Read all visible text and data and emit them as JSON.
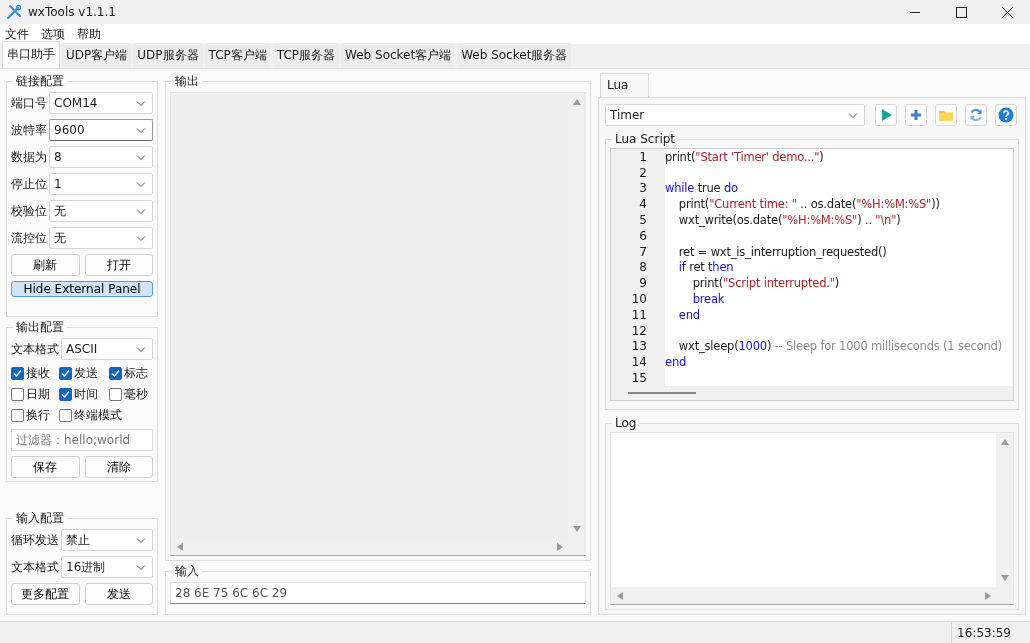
{
  "window": {
    "title": "wxTools v1.1.1"
  },
  "menu": [
    "文件",
    "选项",
    "帮助"
  ],
  "tabs": [
    {
      "label": "串口助手",
      "selected": true
    },
    {
      "label": "UDP客户端",
      "selected": false
    },
    {
      "label": "UDP服务器",
      "selected": false
    },
    {
      "label": "TCP客户端",
      "selected": false
    },
    {
      "label": "TCP服务器",
      "selected": false
    },
    {
      "label": "Web Socket客户端",
      "selected": false
    },
    {
      "label": "Web Socket服务器",
      "selected": false
    }
  ],
  "link_config": {
    "title": "链接配置",
    "fields": [
      {
        "label": "端口号",
        "value": "COM14",
        "focused": false
      },
      {
        "label": "波特率",
        "value": "9600",
        "focused": true
      },
      {
        "label": "数据为",
        "value": "8",
        "focused": false
      },
      {
        "label": "停止位",
        "value": "1",
        "focused": false
      },
      {
        "label": "校验位",
        "value": "无",
        "focused": false
      },
      {
        "label": "流控位",
        "value": "无",
        "focused": false
      }
    ],
    "buttons": [
      "刷新",
      "打开"
    ],
    "panel_button": "Hide External Panel"
  },
  "output_config": {
    "title": "输出配置",
    "format": {
      "label": "文本格式",
      "value": "ASCII"
    },
    "options": [
      {
        "label": "接收",
        "checked": true
      },
      {
        "label": "发送",
        "checked": true
      },
      {
        "label": "标志",
        "checked": true
      },
      {
        "label": "日期",
        "checked": false
      },
      {
        "label": "时间",
        "checked": true
      },
      {
        "label": "毫秒",
        "checked": false
      },
      {
        "label": "换行",
        "checked": false
      },
      {
        "label": "终端模式",
        "checked": false
      }
    ],
    "filter": {
      "placeholder": "过滤器：hello;world"
    },
    "buttons": [
      "保存",
      "清除"
    ]
  },
  "input_config": {
    "title": "输入配置",
    "fields": [
      {
        "label": "循环发送",
        "value": "禁止"
      },
      {
        "label": "文本格式",
        "value": "16进制"
      }
    ],
    "buttons": [
      "更多配置",
      "发送"
    ]
  },
  "output": {
    "title": "输出"
  },
  "input": {
    "title": "输入",
    "value": "28 6E 75 6C 6C 29"
  },
  "side_tabs": [
    {
      "label": "Lua",
      "selected": true
    }
  ],
  "script_select": {
    "value": "Timer"
  },
  "script": {
    "title": "Lua Script",
    "lines": [
      {
        "number": "1",
        "tokens": [
          {
            "kind": "plain",
            "text": "print("
          },
          {
            "kind": "string",
            "text": "\"Start 'Timer' demo...\""
          },
          {
            "kind": "plain",
            "text": ")"
          }
        ]
      },
      {
        "number": "2"
      },
      {
        "number": "3",
        "tokens": [
          {
            "kind": "keyword",
            "text": "while"
          },
          {
            "kind": "plain",
            "text": " true "
          },
          {
            "kind": "keyword",
            "text": "do"
          }
        ]
      },
      {
        "number": "4",
        "tokens": [
          {
            "kind": "plain",
            "text": "    print("
          },
          {
            "kind": "string",
            "text": "\"Current time: \""
          },
          {
            "kind": "plain",
            "text": " .. os.date("
          },
          {
            "kind": "string",
            "text": "\"%H:%M:%S\""
          },
          {
            "kind": "plain",
            "text": "))"
          }
        ]
      },
      {
        "number": "5",
        "tokens": [
          {
            "kind": "plain",
            "text": "    wxt_write(os.date("
          },
          {
            "kind": "string",
            "text": "\"%H:%M:%S\""
          },
          {
            "kind": "plain",
            "text": ") .. "
          },
          {
            "kind": "string",
            "text": "\"\\n\""
          },
          {
            "kind": "plain",
            "text": ")"
          }
        ]
      },
      {
        "number": "6"
      },
      {
        "number": "7",
        "tokens": [
          {
            "kind": "plain",
            "text": "    ret = wxt_is_interruption_requested()"
          }
        ]
      },
      {
        "number": "8",
        "tokens": [
          {
            "kind": "keyword",
            "text": "    if"
          },
          {
            "kind": "plain",
            "text": " ret "
          },
          {
            "kind": "keyword",
            "text": "then"
          }
        ]
      },
      {
        "number": "9",
        "tokens": [
          {
            "kind": "plain",
            "text": "        print("
          },
          {
            "kind": "string",
            "text": "\"Script interrupted.\""
          },
          {
            "kind": "plain",
            "text": ")"
          }
        ]
      },
      {
        "number": "10",
        "tokens": [
          {
            "kind": "keyword",
            "text": "        break"
          }
        ]
      },
      {
        "number": "11",
        "tokens": [
          {
            "kind": "keyword",
            "text": "    end"
          }
        ]
      },
      {
        "number": "12"
      },
      {
        "number": "13",
        "tokens": [
          {
            "kind": "plain",
            "text": "    wxt_sleep("
          },
          {
            "kind": "number",
            "text": "1000"
          },
          {
            "kind": "plain",
            "text": ") "
          },
          {
            "kind": "comment",
            "text": "-- Sleep for 1000 milliseconds (1 second)"
          }
        ]
      },
      {
        "number": "14",
        "tokens": [
          {
            "kind": "keyword",
            "text": "end"
          }
        ]
      },
      {
        "number": "15"
      }
    ]
  },
  "log": {
    "title": "Log"
  },
  "status_bar": {
    "time": "16:53:59"
  }
}
